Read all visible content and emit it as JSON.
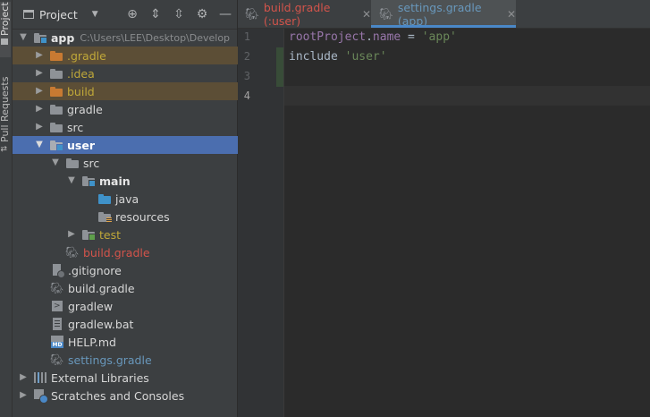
{
  "side_strip": {
    "project_tab": "Project",
    "pull_requests_tab": "Pull Requests"
  },
  "project_panel": {
    "title": "Project"
  },
  "tree": [
    {
      "id": "app",
      "label": "app",
      "path": "C:\\Users\\LEE\\Desktop\\Develop",
      "expanded": true
    },
    {
      "id": "gradle-hidden",
      "label": ".gradle"
    },
    {
      "id": "idea",
      "label": ".idea"
    },
    {
      "id": "build",
      "label": "build"
    },
    {
      "id": "gradle",
      "label": "gradle"
    },
    {
      "id": "src",
      "label": "src"
    },
    {
      "id": "user",
      "label": "user"
    },
    {
      "id": "user-src",
      "label": "src"
    },
    {
      "id": "main",
      "label": "main"
    },
    {
      "id": "java",
      "label": "java"
    },
    {
      "id": "resources",
      "label": "resources"
    },
    {
      "id": "test",
      "label": "test"
    },
    {
      "id": "user-build-gradle",
      "label": "build.gradle"
    },
    {
      "id": "gitignore",
      "label": ".gitignore"
    },
    {
      "id": "build-gradle",
      "label": "build.gradle"
    },
    {
      "id": "gradlew",
      "label": "gradlew"
    },
    {
      "id": "gradlew-bat",
      "label": "gradlew.bat"
    },
    {
      "id": "help-md",
      "label": "HELP.md"
    },
    {
      "id": "settings-gradle",
      "label": "settings.gradle"
    },
    {
      "id": "external-libs",
      "label": "External Libraries"
    },
    {
      "id": "scratches",
      "label": "Scratches and Consoles"
    }
  ],
  "tabs": [
    {
      "label": "build.gradle (:user)",
      "active": false
    },
    {
      "label": "settings.gradle (app)",
      "active": true
    }
  ],
  "editor": {
    "line_numbers": [
      "1",
      "2",
      "3",
      "4"
    ],
    "line1": {
      "ident": "rootProject",
      "dot": ".",
      "prop": "name",
      "op": " = ",
      "str": "'app'"
    },
    "line2": {
      "kw": "include ",
      "str": "'user'"
    }
  },
  "colors": {
    "selection": "#4b6eaf",
    "accent": "#4a88c7",
    "string": "#6a8759",
    "property": "#9876aa"
  }
}
